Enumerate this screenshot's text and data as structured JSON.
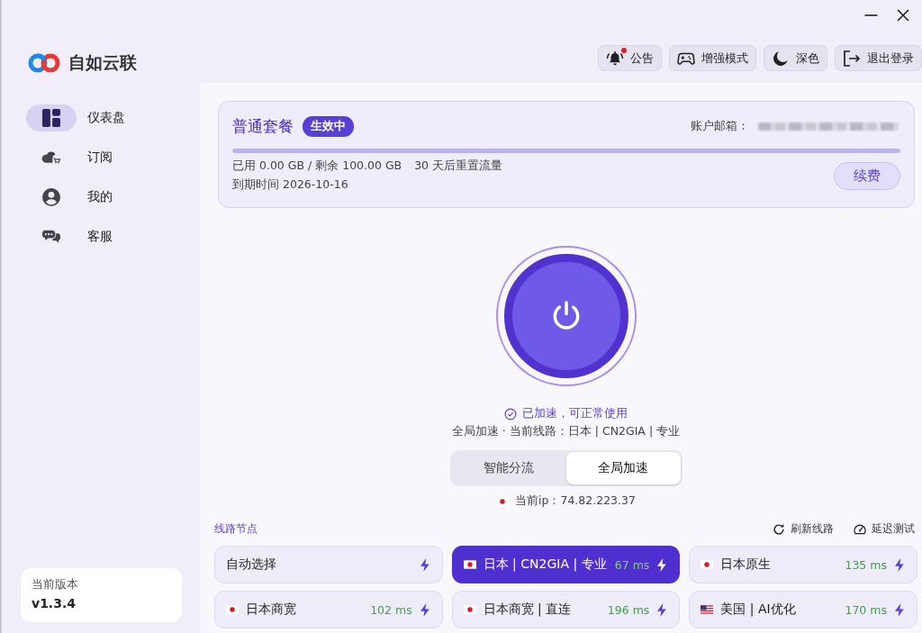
{
  "app": {
    "name": "自如云联"
  },
  "nav": [
    {
      "label": "仪表盘",
      "kind": "dashboard",
      "selected": true
    },
    {
      "label": "订阅",
      "kind": "subscription",
      "selected": false
    },
    {
      "label": "我的",
      "kind": "profile",
      "selected": false
    },
    {
      "label": "客服",
      "kind": "support",
      "selected": false
    }
  ],
  "version": {
    "label": "当前版本",
    "value": "v1.3.4"
  },
  "toolbar": [
    {
      "label": "公告",
      "kind": "notice",
      "unread": true
    },
    {
      "label": "增强模式",
      "kind": "gamepad",
      "unread": false
    },
    {
      "label": "深色",
      "kind": "theme",
      "unread": false
    },
    {
      "label": "退出登录",
      "kind": "logout",
      "unread": false
    }
  ],
  "plan": {
    "name": "普通套餐",
    "status": "生效中",
    "email_label": "账户邮箱：",
    "level": 1,
    "usage": "已用 0.00 GB / 剩余 100.00 GB",
    "reset": "30 天后重置流量",
    "expiry": "到期时间 2026-10-16",
    "renew_button": "续费"
  },
  "connection": {
    "connected": true,
    "status": "已加速，可正常使用",
    "route": "全局加速 · 当前线路：日本 | CN2GIA | 专业",
    "ip": {
      "kind": "jp",
      "text": "当前ip：74.82.223.37"
    }
  },
  "mode_switch": [
    {
      "label": "智能分流",
      "selected": false
    },
    {
      "label": "全局加速",
      "selected": true
    }
  ],
  "nodes": {
    "title": "线路节点",
    "actions": [
      {
        "label": "刷新线路",
        "kind": "refresh"
      },
      {
        "label": "延迟测试",
        "kind": "speed-test"
      }
    ],
    "items": [
      {
        "name": "自动选择",
        "kind": "auto",
        "selected": false
      },
      {
        "name": "日本 | CN2GIA | 专业",
        "kind": "jp",
        "latency": "67 ms",
        "selected": true
      },
      {
        "name": "日本原生",
        "kind": "jp",
        "latency": "135 ms",
        "selected": false
      },
      {
        "name": "日本商宽",
        "kind": "jp",
        "latency": "102 ms",
        "selected": false
      },
      {
        "name": "日本商宽 | 直连",
        "kind": "jp",
        "latency": "196 ms",
        "selected": false
      },
      {
        "name": "美国 | AI优化",
        "kind": "us",
        "latency": "170 ms",
        "selected": false
      }
    ]
  }
}
